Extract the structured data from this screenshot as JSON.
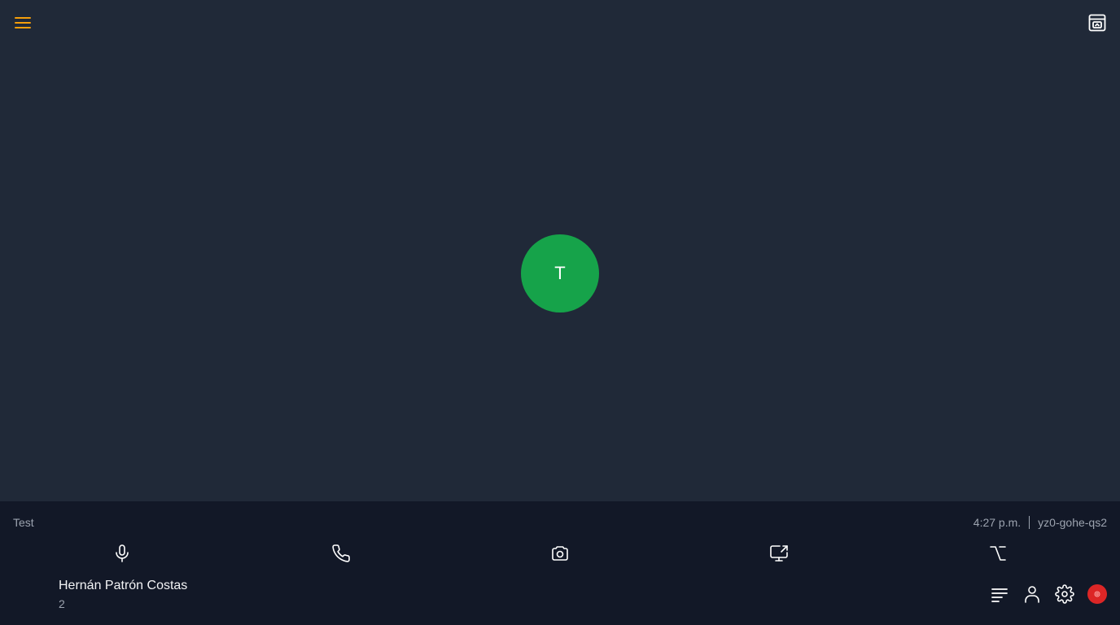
{
  "colors": {
    "stage_background": "#202938",
    "toolbar_background": "#121827",
    "accent": "#f59e0b",
    "avatar": "#16a34a",
    "record_indicator": "#dc2626"
  },
  "top_bar": {
    "menu_icon": "hamburger-menu-icon",
    "pip_icon": "picture-in-picture-icon"
  },
  "participant": {
    "initial": "T"
  },
  "meeting": {
    "name": "Test",
    "time": "4:27 p.m.",
    "code": "yz0-gohe-qs2"
  },
  "controls": [
    {
      "icon": "microphone-icon"
    },
    {
      "icon": "phone-icon"
    },
    {
      "icon": "camera-icon"
    },
    {
      "icon": "screen-share-icon"
    },
    {
      "icon": "option-key-icon"
    }
  ],
  "user": {
    "name": "Hernán Patrón Costas",
    "count": "2"
  },
  "bottom_right": [
    {
      "icon": "list-icon"
    },
    {
      "icon": "user-icon"
    },
    {
      "icon": "gear-icon"
    },
    {
      "icon": "record-indicator-icon"
    }
  ]
}
